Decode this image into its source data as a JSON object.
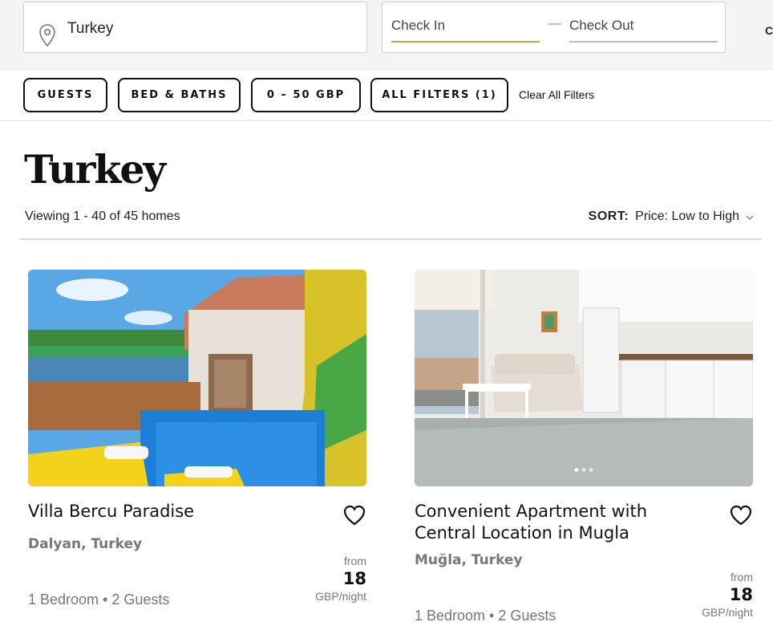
{
  "search": {
    "location_value": "Turkey",
    "check_in_label": "Check In",
    "check_out_label": "Check Out",
    "date_separator": "—",
    "cut_off_text": "C"
  },
  "filters": {
    "guests_label": "GUESTS",
    "beds_label": "BED & BATHS",
    "price_label": "0 – 50 GBP",
    "all_filters_label": "ALL FILTERS (1)",
    "clear_label": "Clear All Filters"
  },
  "results": {
    "title": "Turkey",
    "count_text": "Viewing 1 - 40 of 45 homes",
    "sort_label": "SORT:",
    "sort_value": "Price: Low to High"
  },
  "listings": [
    {
      "name": "Villa Bercu Paradise",
      "location": "Dalyan, Turkey",
      "details": "1 Bedroom • 2 Guests",
      "price_prefix": "from",
      "price": "18",
      "price_unit": "GBP/night"
    },
    {
      "name": "Convenient Apartment with Central Location in Mugla",
      "location": "Muğla, Turkey",
      "details": "1 Bedroom • 2 Guests",
      "price_prefix": "from",
      "price": "18",
      "price_unit": "GBP/night",
      "photo_count_dots": 3,
      "active_dot": 1
    }
  ],
  "icons": {
    "location": "map-pin-icon",
    "favorite": "heart-outline-icon",
    "sort": "chevron-down-icon"
  },
  "colors": {
    "check_in_underline": "#c9a14a",
    "text_primary": "#111111",
    "text_muted": "#777777"
  }
}
